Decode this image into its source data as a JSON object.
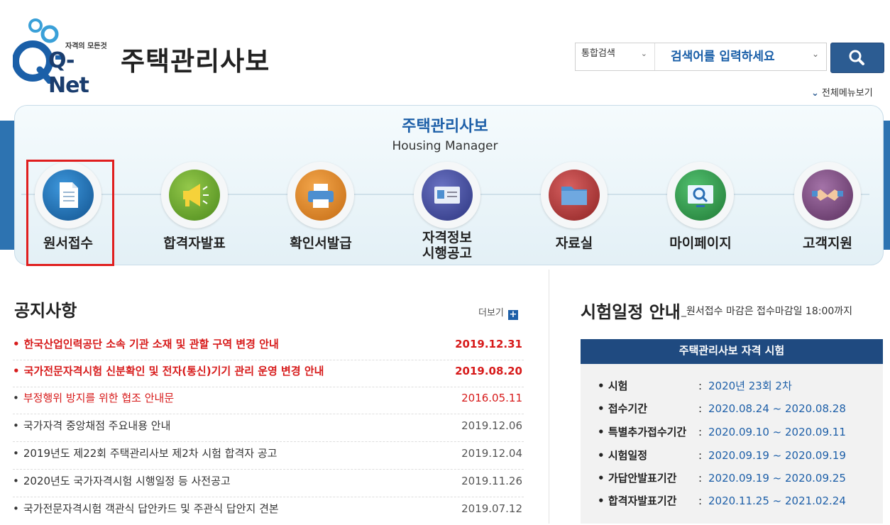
{
  "header": {
    "logo_tagline": "자격의 모든것",
    "logo_text": "Q-Net",
    "title": "주택관리사보",
    "search": {
      "category": "통합검색",
      "placeholder": "검색어를 입력하세요"
    },
    "all_menu": "전체메뉴보기"
  },
  "banner": {
    "title": "주택관리사보",
    "subtitle": "Housing Manager",
    "menu": [
      {
        "label": "원서접수",
        "icon": "document-icon",
        "color": "#1e6fb7"
      },
      {
        "label": "합격자발표",
        "icon": "megaphone-icon",
        "color": "#6aa62b"
      },
      {
        "label": "확인서발급",
        "icon": "printer-icon",
        "color": "#e08a2c"
      },
      {
        "label_line1": "자격정보",
        "label_line2": "시행공고",
        "icon": "id-card-icon",
        "color": "#3e4a93"
      },
      {
        "label": "자료실",
        "icon": "folder-icon",
        "color": "#b33a3a"
      },
      {
        "label": "마이페이지",
        "icon": "monitor-search-icon",
        "color": "#2f9a4a"
      },
      {
        "label": "고객지원",
        "icon": "handshake-icon",
        "color": "#7b4a7e"
      }
    ]
  },
  "notices": {
    "title": "공지사항",
    "more": "더보기",
    "items": [
      {
        "text": "한국산업인력공단 소속 기관 소재 및 관할 구역 변경 안내",
        "date": "2019.12.31",
        "style": "red-bold"
      },
      {
        "text": "국가전문자격시험 신분확인 및 전자(통신)기기 관리 운영 변경 안내",
        "date": "2019.08.20",
        "style": "red-bold"
      },
      {
        "text": "부정행위 방지를 위한 협조 안내문",
        "date": "2016.05.11",
        "style": "red"
      },
      {
        "text": "국가자격 중앙채점 주요내용 안내",
        "date": "2019.12.06",
        "style": "normal"
      },
      {
        "text": "2019년도 제22회 주택관리사보 제2차 시험 합격자 공고",
        "date": "2019.12.04",
        "style": "normal"
      },
      {
        "text": "2020년도 국가자격시험 시행일정 등 사전공고",
        "date": "2019.11.26",
        "style": "normal"
      },
      {
        "text": "국가전문자격시험 객관식 답안카드 및 주관식 답안지 견본",
        "date": "2019.07.12",
        "style": "normal"
      }
    ]
  },
  "schedule": {
    "title": "시험일정 안내",
    "subtitle": "_원서접수 마감은 접수마감일 18:00까지",
    "box_title": "주택관리사보 자격 시험",
    "rows": [
      {
        "key": "시험",
        "value": "2020년 23회 2차"
      },
      {
        "key": "접수기간",
        "value": "2020.08.24 ~ 2020.08.28"
      },
      {
        "key": "특별추가접수기간",
        "value": "2020.09.10 ~ 2020.09.11"
      },
      {
        "key": "시험일정",
        "value": "2020.09.19 ~ 2020.09.19"
      },
      {
        "key": "가답안발표기간",
        "value": "2020.09.19 ~ 2020.09.25"
      },
      {
        "key": "합격자발표기간",
        "value": "2020.11.25 ~ 2021.02.24"
      }
    ]
  },
  "colors": {
    "accent": "#1d5fa8",
    "header_bar": "#1f4a80",
    "highlight": "#e01e1e",
    "notice_red": "#d71a1a"
  }
}
